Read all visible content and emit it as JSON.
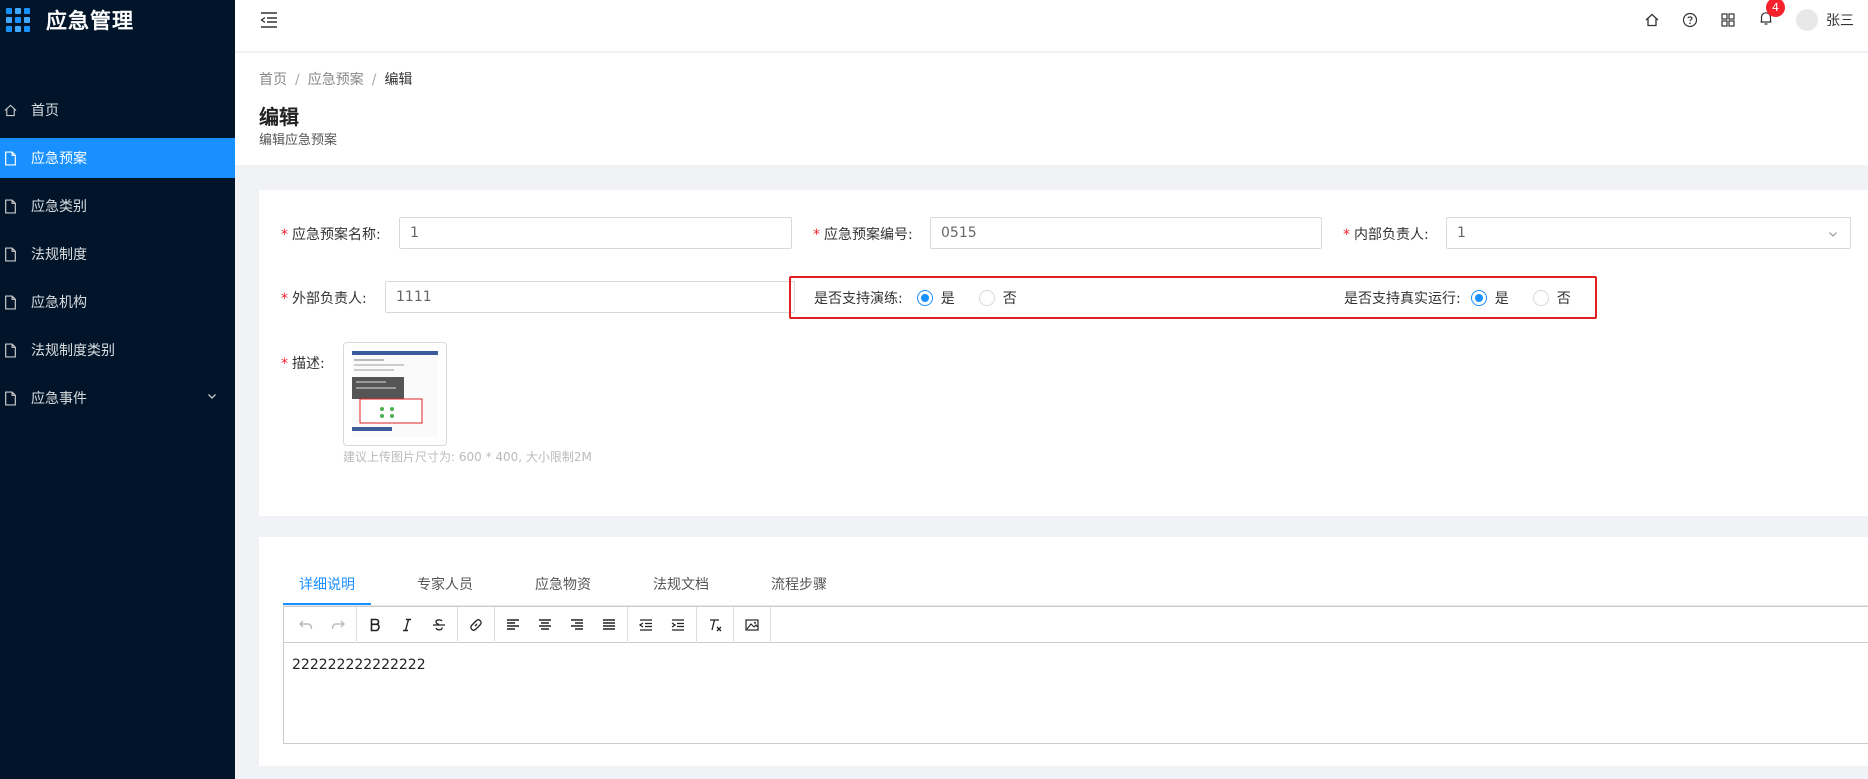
{
  "app": {
    "title": "应急管理"
  },
  "sidebar": {
    "items": [
      {
        "label": "首页",
        "icon": "home-icon",
        "active": false
      },
      {
        "label": "应急预案",
        "icon": "document-icon",
        "active": true
      },
      {
        "label": "应急类别",
        "icon": "document-icon",
        "active": false
      },
      {
        "label": "法规制度",
        "icon": "document-icon",
        "active": false
      },
      {
        "label": "应急机构",
        "icon": "document-icon",
        "active": false
      },
      {
        "label": "法规制度类别",
        "icon": "document-icon",
        "active": false
      },
      {
        "label": "应急事件",
        "icon": "document-icon",
        "active": false,
        "has_submenu": true
      }
    ]
  },
  "header": {
    "notification_count": "4",
    "user_name": "张三",
    "icons": [
      "home-icon",
      "help-icon",
      "apps-grid-icon",
      "bell-icon"
    ]
  },
  "breadcrumb": {
    "items": [
      "首页",
      "应急预案",
      "编辑"
    ]
  },
  "page": {
    "title": "编辑",
    "subtitle": "编辑应急预案"
  },
  "form": {
    "plan_name": {
      "label": "应急预案名称:",
      "value": "1"
    },
    "plan_code": {
      "label": "应急预案编号:",
      "value": "0515"
    },
    "internal_owner": {
      "label": "内部负责人:",
      "value": "1"
    },
    "external_owner": {
      "label": "外部负责人:",
      "value": "1111"
    },
    "supports_drill": {
      "label": "是否支持演练:",
      "options": [
        "是",
        "否"
      ],
      "selected": "是"
    },
    "supports_real_run": {
      "label": "是否支持真实运行:",
      "options": [
        "是",
        "否"
      ],
      "selected": "是"
    },
    "description": {
      "label": "描述:",
      "hint": "建议上传图片尺寸为: 600 * 400, 大小限制2M"
    }
  },
  "tabs": {
    "items": [
      "详细说明",
      "专家人员",
      "应急物资",
      "法规文档",
      "流程步骤"
    ],
    "active": "详细说明"
  },
  "editor": {
    "content": "222222222222222",
    "toolbar": [
      "undo-icon",
      "redo-icon",
      "bold-icon",
      "italic-icon",
      "strikethrough-icon",
      "link-icon",
      "align-left-icon",
      "align-center-icon",
      "align-right-icon",
      "align-justify-icon",
      "outdent-icon",
      "indent-icon",
      "clear-format-icon",
      "image-icon"
    ]
  },
  "colors": {
    "primary": "#1890ff",
    "sidebar_bg": "#001529",
    "required": "#f5222d",
    "highlight_border": "#e02020"
  }
}
